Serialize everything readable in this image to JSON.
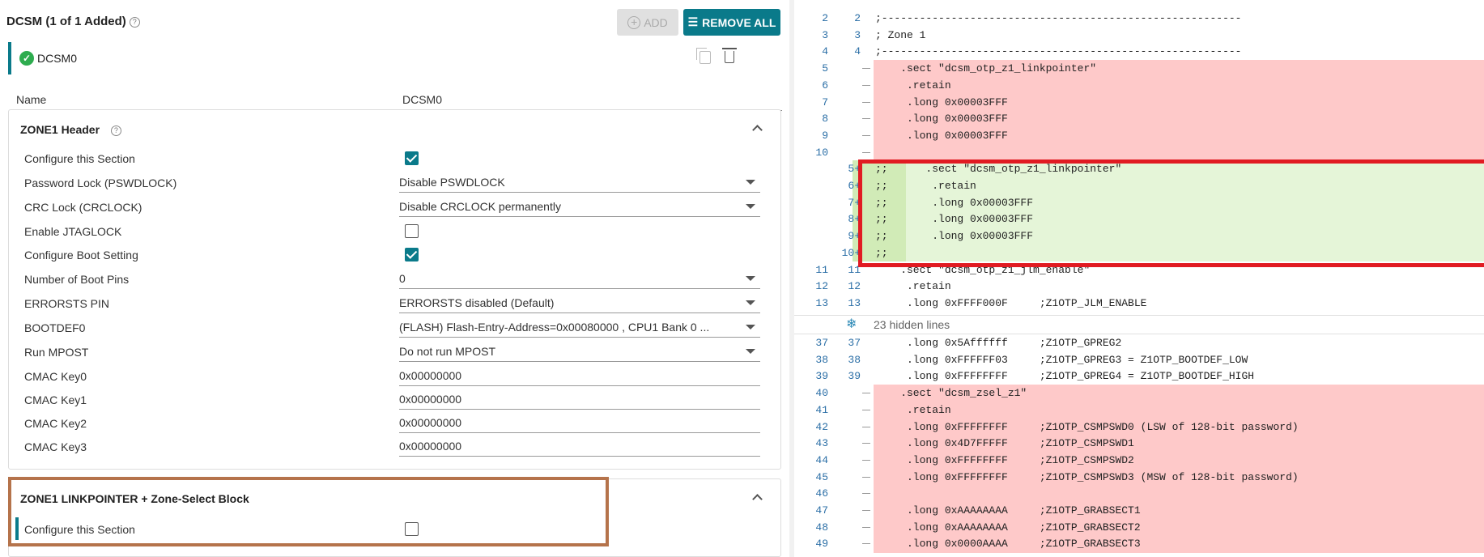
{
  "header": {
    "title": "DCSM (1 of 1 Added)",
    "add_label": "ADD",
    "remove_all_label": "REMOVE ALL"
  },
  "instance": {
    "name": "DCSM0"
  },
  "name_field": {
    "label": "Name",
    "value": "DCSM0"
  },
  "zone1_header": {
    "title": "ZONE1 Header",
    "rows": [
      {
        "label": "Configure this Section",
        "type": "checkbox",
        "checked": true
      },
      {
        "label": "Password Lock (PSWDLOCK)",
        "type": "dropdown",
        "value": "Disable PSWDLOCK"
      },
      {
        "label": "CRC Lock (CRCLOCK)",
        "type": "dropdown",
        "value": "Disable CRCLOCK permanently"
      },
      {
        "label": "Enable JTAGLOCK",
        "type": "checkbox",
        "checked": false
      },
      {
        "label": "Configure Boot Setting",
        "type": "checkbox",
        "checked": true
      },
      {
        "label": "Number of Boot Pins",
        "type": "dropdown",
        "value": "0"
      },
      {
        "label": "ERRORSTS PIN",
        "type": "dropdown",
        "value": "ERRORSTS disabled (Default)"
      },
      {
        "label": "BOOTDEF0",
        "type": "dropdown",
        "value": "(FLASH) Flash-Entry-Address=0x00080000 , CPU1 Bank 0 ..."
      },
      {
        "label": "Run MPOST",
        "type": "dropdown",
        "value": "Do not run MPOST"
      },
      {
        "label": "CMAC Key0",
        "type": "text",
        "value": "0x00000000"
      },
      {
        "label": "CMAC Key1",
        "type": "text",
        "value": "0x00000000"
      },
      {
        "label": "CMAC Key2",
        "type": "text",
        "value": "0x00000000"
      },
      {
        "label": "CMAC Key3",
        "type": "text",
        "value": "0x00000000"
      }
    ]
  },
  "zone1_linkpointer": {
    "title": "ZONE1 LINKPOINTER + Zone-Select Block",
    "rows": [
      {
        "label": "Configure this Section",
        "type": "checkbox",
        "checked": false
      }
    ]
  },
  "diff": {
    "hidden_lines_label": "23 hidden lines",
    "lines": [
      {
        "l": "2",
        "r": "2",
        "kind": "ctx",
        "text": ";---------------------------------------------------------"
      },
      {
        "l": "3",
        "r": "3",
        "kind": "ctx",
        "text": "; Zone 1"
      },
      {
        "l": "4",
        "r": "4",
        "kind": "ctx",
        "text": ";---------------------------------------------------------"
      },
      {
        "l": "5",
        "r": "",
        "kind": "del",
        "text": "    .sect \"dcsm_otp_z1_linkpointer\""
      },
      {
        "l": "6",
        "r": "",
        "kind": "del",
        "text": "     .retain"
      },
      {
        "l": "7",
        "r": "",
        "kind": "del",
        "text": "     .long 0x00003FFF"
      },
      {
        "l": "8",
        "r": "",
        "kind": "del",
        "text": "     .long 0x00003FFF"
      },
      {
        "l": "9",
        "r": "",
        "kind": "del",
        "text": "     .long 0x00003FFF"
      },
      {
        "l": "10",
        "r": "",
        "kind": "del",
        "text": ""
      },
      {
        "l": "",
        "r": "5+",
        "kind": "add",
        "text": ";;      .sect \"dcsm_otp_z1_linkpointer\""
      },
      {
        "l": "",
        "r": "6+",
        "kind": "add",
        "text": ";;       .retain"
      },
      {
        "l": "",
        "r": "7+",
        "kind": "add",
        "text": ";;       .long 0x00003FFF"
      },
      {
        "l": "",
        "r": "8+",
        "kind": "add",
        "text": ";;       .long 0x00003FFF"
      },
      {
        "l": "",
        "r": "9+",
        "kind": "add",
        "text": ";;       .long 0x00003FFF"
      },
      {
        "l": "",
        "r": "10+",
        "kind": "add",
        "text": ";;"
      },
      {
        "l": "11",
        "r": "11",
        "kind": "ctx",
        "text": "    .sect \"dcsm_otp_z1_jlm_enable\""
      },
      {
        "l": "12",
        "r": "12",
        "kind": "ctx",
        "text": "     .retain"
      },
      {
        "l": "13",
        "r": "13",
        "kind": "ctx",
        "text": "     .long 0xFFFF000F     ;Z1OTP_JLM_ENABLE"
      },
      {
        "l": "37",
        "r": "37",
        "kind": "ctx",
        "text": "     .long 0x5Affffff     ;Z1OTP_GPREG2"
      },
      {
        "l": "38",
        "r": "38",
        "kind": "ctx",
        "text": "     .long 0xFFFFFF03     ;Z1OTP_GPREG3 = Z1OTP_BOOTDEF_LOW"
      },
      {
        "l": "39",
        "r": "39",
        "kind": "ctx",
        "text": "     .long 0xFFFFFFFF     ;Z1OTP_GPREG4 = Z1OTP_BOOTDEF_HIGH"
      },
      {
        "l": "40",
        "r": "",
        "kind": "del",
        "text": "    .sect \"dcsm_zsel_z1\""
      },
      {
        "l": "41",
        "r": "",
        "kind": "del",
        "text": "     .retain"
      },
      {
        "l": "42",
        "r": "",
        "kind": "del",
        "text": "     .long 0xFFFFFFFF     ;Z1OTP_CSMPSWD0 (LSW of 128-bit password)"
      },
      {
        "l": "43",
        "r": "",
        "kind": "del",
        "text": "     .long 0x4D7FFFFF     ;Z1OTP_CSMPSWD1"
      },
      {
        "l": "44",
        "r": "",
        "kind": "del",
        "text": "     .long 0xFFFFFFFF     ;Z1OTP_CSMPSWD2"
      },
      {
        "l": "45",
        "r": "",
        "kind": "del",
        "text": "     .long 0xFFFFFFFF     ;Z1OTP_CSMPSWD3 (MSW of 128-bit password)"
      },
      {
        "l": "46",
        "r": "",
        "kind": "del",
        "text": ""
      },
      {
        "l": "47",
        "r": "",
        "kind": "del",
        "text": "     .long 0xAAAAAAAA     ;Z1OTP_GRABSECT1"
      },
      {
        "l": "48",
        "r": "",
        "kind": "del",
        "text": "     .long 0xAAAAAAAA     ;Z1OTP_GRABSECT2"
      },
      {
        "l": "49",
        "r": "",
        "kind": "del",
        "text": "     .long 0x0000AAAA     ;Z1OTP_GRABSECT3"
      }
    ]
  }
}
